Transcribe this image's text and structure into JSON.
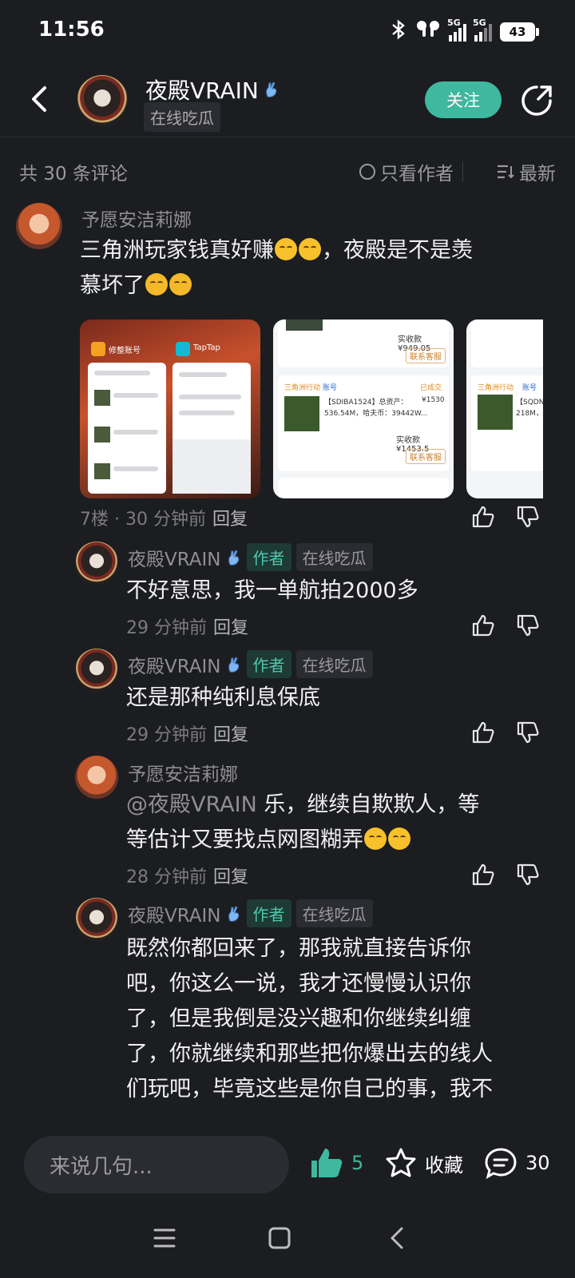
{
  "status": {
    "time": "11:56",
    "battery": "43",
    "net1": "5G",
    "net2": "5G"
  },
  "header": {
    "name": "夜殿VRAIN",
    "tag": "在线吃瓜",
    "follow_label": "关注"
  },
  "meta": {
    "count": "共 30 条评论",
    "author_only": "只看作者",
    "sort": "最新"
  },
  "comments": [
    {
      "name": "予愿安洁莉娜",
      "text_a": "三角洲玩家钱真好赚",
      "text_b": "，夜殿是不是羡",
      "text_c": "慕坏了",
      "meta": "7楼 · 30 分钟前",
      "reply": "回复"
    },
    {
      "name": "夜殿VRAIN",
      "badge": "作者",
      "tag": "在线吃瓜",
      "text": "不好意思，我一单航拍2000多",
      "meta": "29 分钟前",
      "reply": "回复"
    },
    {
      "name": "夜殿VRAIN",
      "badge": "作者",
      "tag": "在线吃瓜",
      "text": "还是那种纯利息保底",
      "meta": "29 分钟前",
      "reply": "回复"
    },
    {
      "name": "予愿安洁莉娜",
      "mention": "@夜殿VRAIN",
      "text_a": " 乐，继续自欺欺人，等",
      "text_b": "等估计又要找点网图糊弄",
      "meta": "28 分钟前",
      "reply": "回复"
    },
    {
      "name": "夜殿VRAIN",
      "badge": "作者",
      "tag": "在线吃瓜",
      "lines": [
        "既然你都回来了，那我就直接告诉你",
        "吧，你这么一说，我才还慢慢认识你",
        "了，但是我倒是没兴趣和你继续纠缠",
        "了，你就继续和那些把你爆出去的线人",
        "们玩吧，毕竟这些是你自己的事，我不"
      ]
    }
  ],
  "images": {
    "img1_app_a": "修整账号",
    "img1_app_b": "TapTap",
    "img2_price1": "实收款 ¥949.05",
    "img2_btn1": "联系客服",
    "img2_game": "三角洲行动",
    "img2_account": "账号",
    "img2_status": "已成交",
    "img2_desc1": "【SDIBA1524】总资产：",
    "img2_desc2": "536.54M，哈夫币：39442W...",
    "img2_price_main": "¥1530",
    "img2_price2": "实收款 ¥1453.5",
    "img2_btn2": "联系客服",
    "img3_code": "【SQDNF8",
    "img3_desc": "218M，哈"
  },
  "bottom": {
    "input_placeholder": "来说几句...",
    "likes": "5",
    "favorite": "收藏",
    "comments": "30"
  },
  "colors": {
    "accent": "#3fb8a0",
    "background": "#1c1d21"
  }
}
